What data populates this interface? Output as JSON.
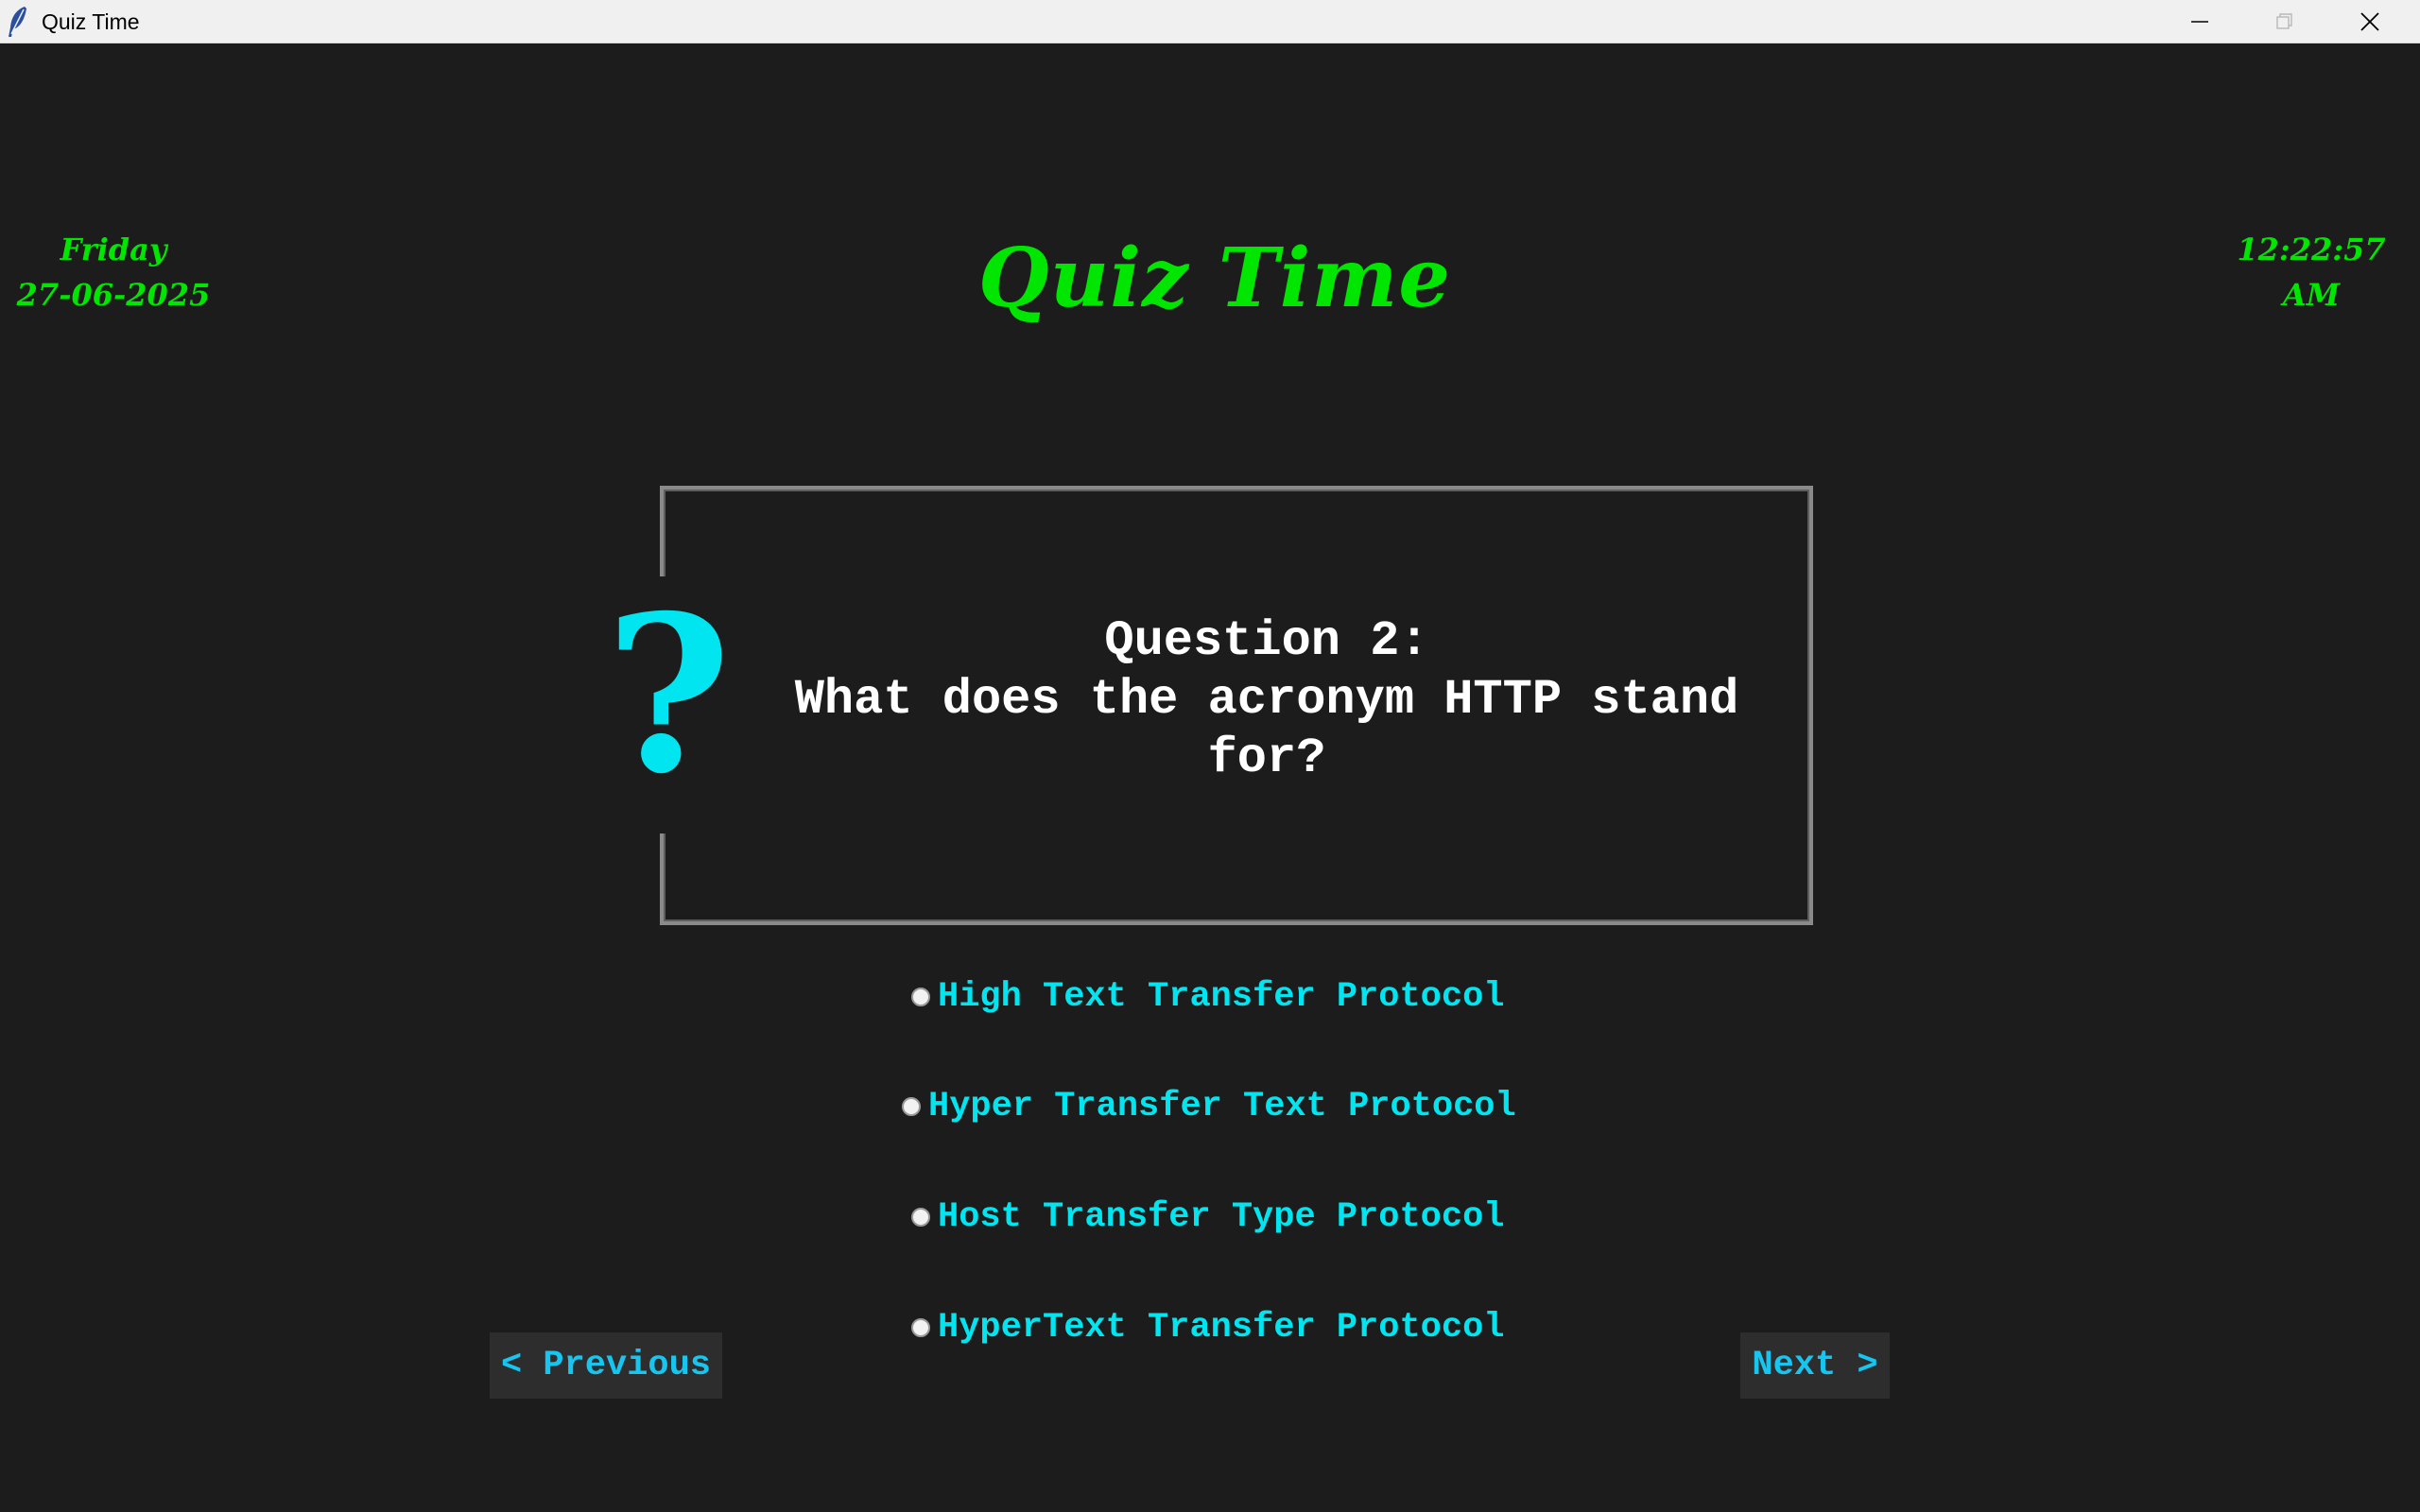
{
  "window": {
    "title": "Quiz Time",
    "icon": "feather-icon",
    "controls": [
      "minimize-icon",
      "maximize-icon",
      "close-icon"
    ]
  },
  "header": {
    "day": "Friday",
    "date": "27-06-2025",
    "title": "Quiz Time",
    "time": "12:22:57",
    "meridiem": "AM"
  },
  "question": {
    "heading": "Question 2:",
    "text_line1": "What does the acronym HTTP stand",
    "text_line2": "for?",
    "icon": "question-mark-icon"
  },
  "options": [
    {
      "label": "High Text Transfer Protocol",
      "selected": false
    },
    {
      "label": "Hyper Transfer Text Protocol",
      "selected": false
    },
    {
      "label": "Host Transfer Type Protocol",
      "selected": false
    },
    {
      "label": "HyperText Transfer Protocol",
      "selected": false
    }
  ],
  "nav": {
    "previous_label": "< Previous",
    "next_label": "Next >"
  },
  "colors": {
    "background": "#1c1c1c",
    "header_text": "#00e600",
    "accent_cyan": "#00e5f0",
    "button_text": "#17c6f0",
    "button_bg": "#2d2d2d",
    "question_text": "#ffffff"
  }
}
